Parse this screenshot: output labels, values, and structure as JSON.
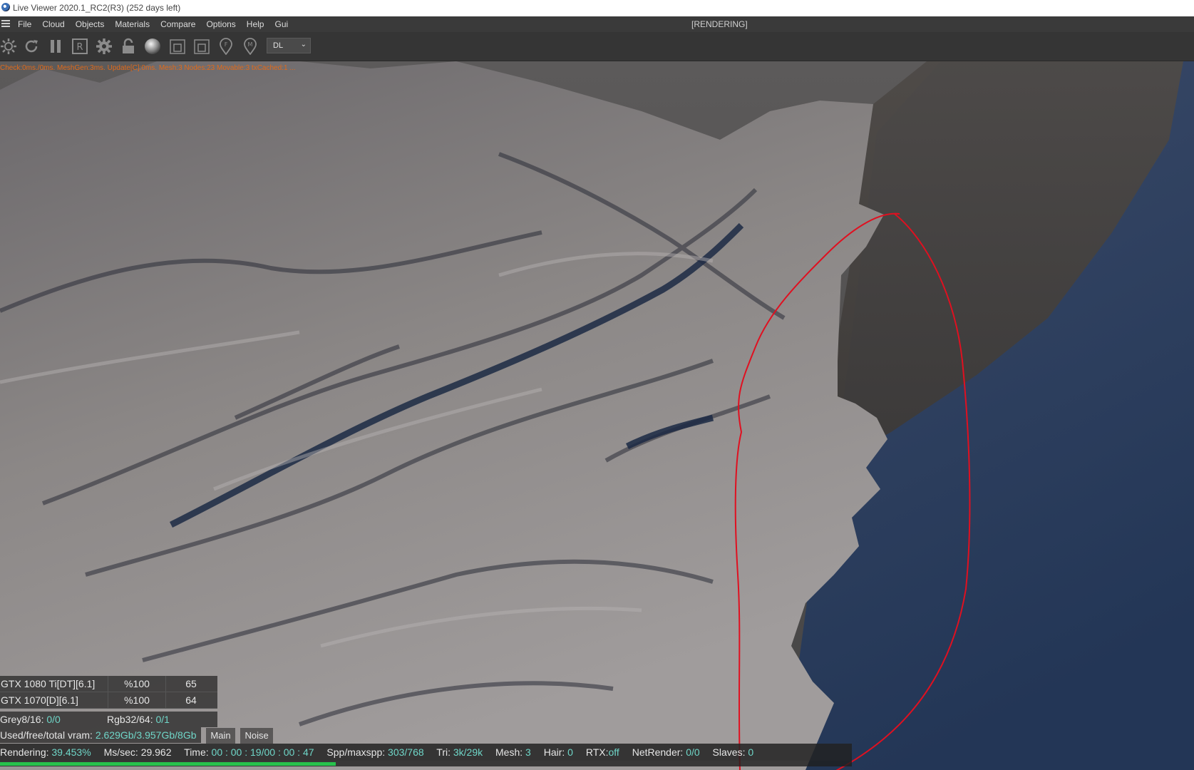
{
  "window": {
    "title": "Live Viewer 2020.1_RC2(R3) (252 days left)"
  },
  "menu": {
    "items": [
      "File",
      "Cloud",
      "Objects",
      "Materials",
      "Compare",
      "Options",
      "Help",
      "Gui"
    ],
    "status": "[RENDERING]"
  },
  "toolbar": {
    "icons": [
      "settings-sun-icon",
      "refresh-icon",
      "pause-icon",
      "region-render-icon",
      "gear-icon",
      "lock-icon",
      "material-ball-icon",
      "frame-icon",
      "frame-alt-icon",
      "pin-f-icon",
      "pin-m-icon"
    ],
    "kernel_select": {
      "value": "DL"
    }
  },
  "viewport": {
    "render_stats": "Check:0ms./0ms. MeshGen:3ms. Update[C]:0ms. Mesh:3 Nodes:23 Movable:3 txCached:1 ..."
  },
  "gpus": [
    {
      "name": "GTX 1080 Ti[DT][6.1]",
      "usage": "%100",
      "temp": "65"
    },
    {
      "name": "GTX 1070[D][6.1]",
      "usage": "%100",
      "temp": "64"
    }
  ],
  "memory": {
    "grey_label": "Grey8/16:",
    "grey_value": "0/0",
    "rgb_label": "Rgb32/64:",
    "rgb_value": "0/1",
    "vram_label": "Used/free/total vram:",
    "vram_value": "2.629Gb/3.957Gb/8Gb",
    "tabs": [
      "Main",
      "Noise"
    ]
  },
  "status": {
    "rendering_label": "Rendering:",
    "rendering_value": "39.453%",
    "mssec_label": "Ms/sec:",
    "mssec_value": "29.962",
    "time_label": "Time:",
    "time_value": "00 : 00 : 19/00 : 00 : 47",
    "spp_label": "Spp/maxspp:",
    "spp_value": "303/768",
    "tri_label": "Tri:",
    "tri_value": "3k/29k",
    "mesh_label": "Mesh:",
    "mesh_value": "3",
    "hair_label": "Hair:",
    "hair_value": "0",
    "rtx_label": "RTX:",
    "rtx_value": "off",
    "netrender_label": "NetRender:",
    "netrender_value": "0/0",
    "slaves_label": "Slaves:",
    "slaves_value": "0",
    "progress": 0.39453
  },
  "colors": {
    "accent_value": "#6fd6c8",
    "stats_text": "#e06a1a",
    "progress": "#27c24c",
    "annotation": "#e01020"
  }
}
